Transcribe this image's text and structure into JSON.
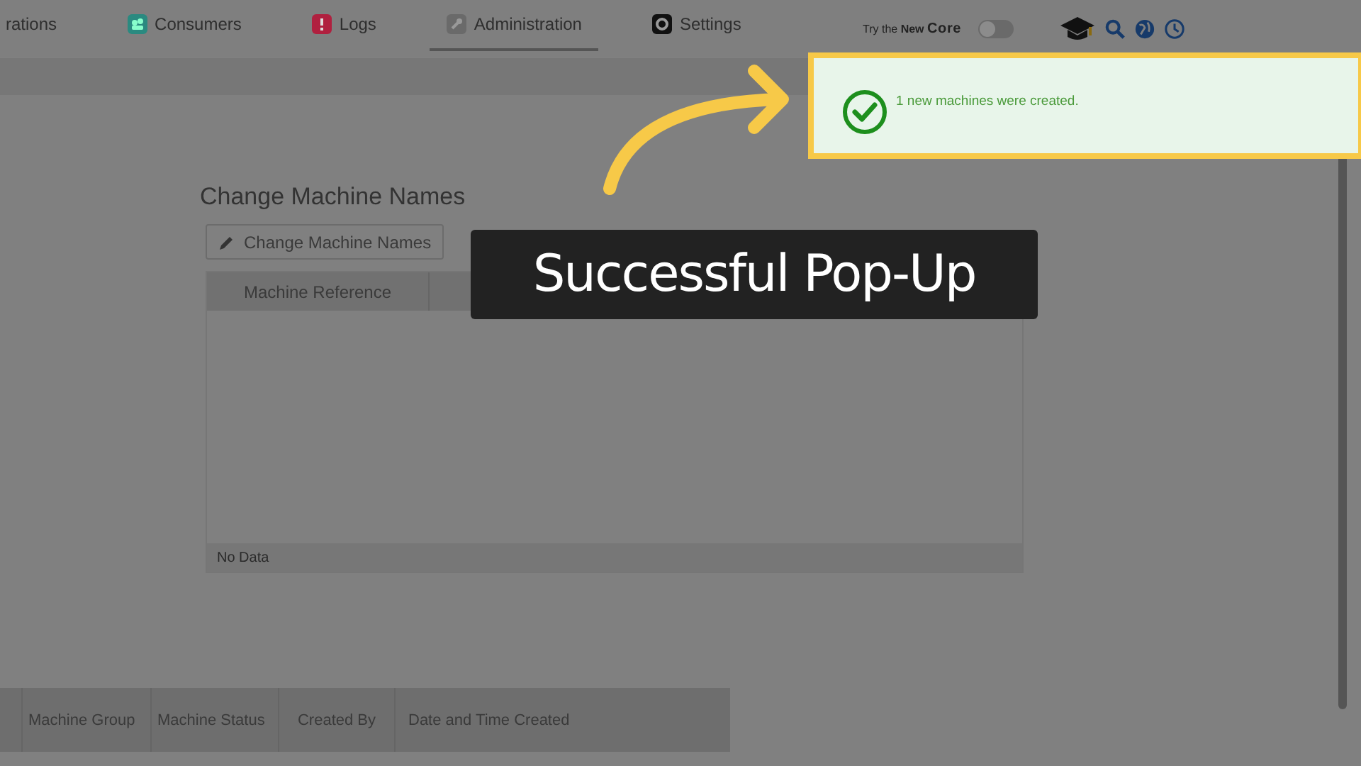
{
  "nav": {
    "tabs": [
      {
        "label": "rations",
        "kind": "none",
        "selected": false
      },
      {
        "label": "Consumers",
        "kind": "consumers",
        "selected": false
      },
      {
        "label": "Logs",
        "kind": "logs",
        "selected": false
      },
      {
        "label": "Administration",
        "kind": "admin",
        "selected": true
      },
      {
        "label": "Settings",
        "kind": "settings",
        "selected": false
      }
    ],
    "try_core": {
      "prefix": "Try the",
      "new": "New",
      "core": "Core",
      "on": false
    }
  },
  "toast": {
    "message": "1 new machines were created."
  },
  "panel": {
    "title": "Change Machine Names",
    "button": "Change Machine Names",
    "columns": [
      "Machine Reference"
    ],
    "empty_text": "No Data"
  },
  "lower_table": {
    "columns": [
      "Machine Group",
      "Machine Status",
      "Created By",
      "Date and Time Created"
    ]
  },
  "annotation": {
    "caption": "Successful Pop-Up"
  }
}
